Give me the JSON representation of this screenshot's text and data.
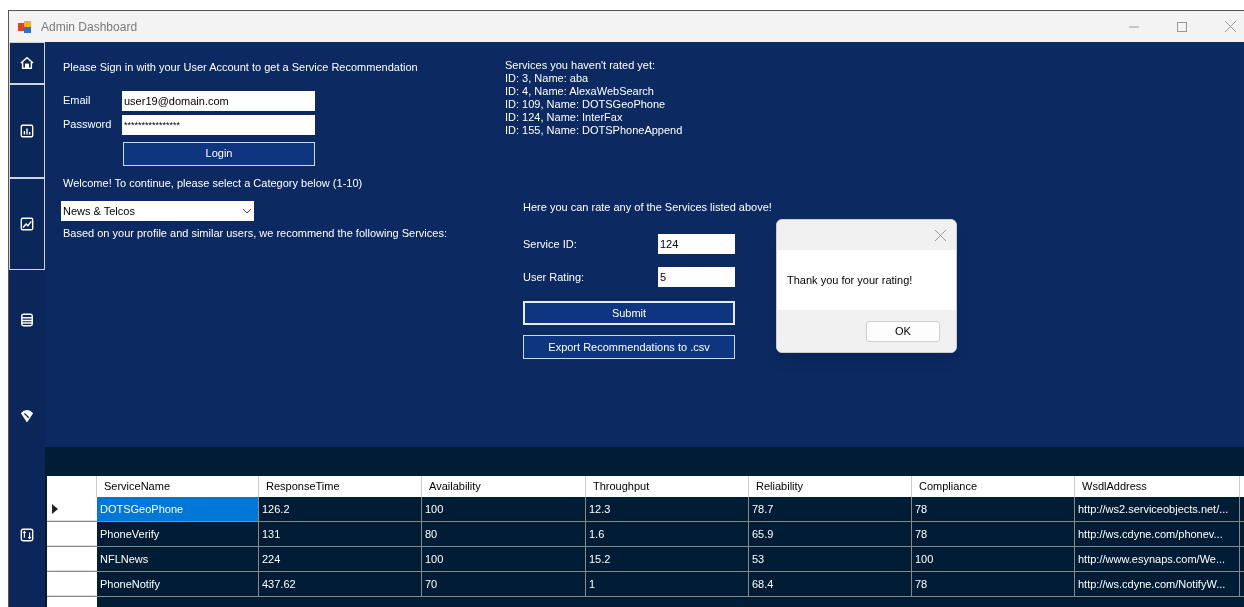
{
  "window": {
    "title": "Admin Dashboard"
  },
  "login": {
    "prompt": "Please Sign in with your User Account to get a Service Recommendation",
    "email_label": "Email",
    "email": "user19@domain.com",
    "password_label": "Password",
    "password": "****************",
    "button": "Login"
  },
  "category": {
    "prompt": "Welcome! To continue, please select a Category below (1-10)",
    "value": "News & Telcos",
    "note": "Based on your profile and similar users, we recommend the following Services:"
  },
  "unrated": {
    "title": "Services you haven't rated yet:",
    "items": [
      "ID: 3, Name: aba",
      "ID: 4, Name: AlexaWebSearch",
      "ID: 109, Name: DOTSGeoPhone",
      "ID: 124, Name: InterFax",
      "ID: 155, Name: DOTSPhoneAppend"
    ]
  },
  "rating": {
    "prompt": "Here you can rate any of the Services listed above!",
    "service_id_label": "Service ID:",
    "service_id": "124",
    "user_rating_label": "User Rating:",
    "user_rating": "5",
    "submit": "Submit",
    "export": "Export Recommendations to .csv"
  },
  "dialog": {
    "message": "Thank you for your rating!",
    "ok": "OK"
  },
  "table": {
    "columns": [
      "ServiceName",
      "ResponseTime",
      "Availability",
      "Throughput",
      "Reliability",
      "Compliance",
      "WsdlAddress"
    ],
    "rows": [
      {
        "selected": true,
        "cells": [
          "DOTSGeoPhone",
          "126.2",
          "100",
          "12.3",
          "78.7",
          "78",
          "http://ws2.serviceobjects.net/..."
        ]
      },
      {
        "selected": false,
        "cells": [
          "PhoneVerify",
          "131",
          "80",
          "1.6",
          "65.9",
          "78",
          "http://ws.cdyne.com/phonev..."
        ]
      },
      {
        "selected": false,
        "cells": [
          "NFLNews",
          "224",
          "100",
          "15.2",
          "53",
          "100",
          "http://www.esynaps.com/We..."
        ]
      },
      {
        "selected": false,
        "cells": [
          "PhoneNotify",
          "437.62",
          "70",
          "1",
          "68.4",
          "78",
          "http://ws.cdyne.com/NotifyW..."
        ]
      }
    ]
  }
}
